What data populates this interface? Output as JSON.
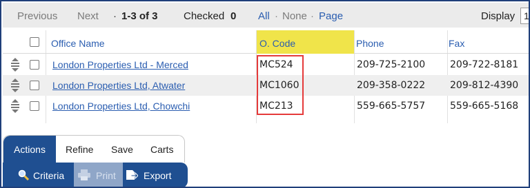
{
  "pager": {
    "previous": "Previous",
    "next": "Next",
    "dot1": "·",
    "range": "1-3 of 3",
    "checked_label": "Checked",
    "checked_count": "0",
    "all": "All",
    "dot2": "·",
    "none": "None",
    "dot3": "·",
    "page": "Page",
    "display_label": "Display",
    "display_value": "1"
  },
  "table": {
    "columns": [
      "Office Name",
      "O. Code",
      "Phone",
      "Fax"
    ],
    "rows": [
      {
        "name": "London Properties Ltd - Merced",
        "code": "MC524",
        "phone": "209-725-2100",
        "fax": "209-722-8181"
      },
      {
        "name": "London Properties Ltd, Atwater",
        "code": "MC1060",
        "phone": "209-358-0222",
        "fax": "209-812-4390"
      },
      {
        "name": "London Properties Ltd, Chowchi",
        "code": "MC213",
        "phone": "559-665-5757",
        "fax": "559-665-5168"
      }
    ]
  },
  "tabs": {
    "actions": "Actions",
    "refine": "Refine",
    "save": "Save",
    "carts": "Carts"
  },
  "actions": {
    "criteria": "Criteria",
    "print": "Print",
    "export": "Export"
  },
  "colors": {
    "accent": "#1f4f91",
    "link": "#2a5db0",
    "highlight_header": "#f0e44a",
    "highlight_box": "#e53a3a"
  },
  "icons": {
    "drag": "drag-handle-icon",
    "criteria": "magnifier-icon",
    "print": "printer-icon",
    "export": "export-icon"
  }
}
